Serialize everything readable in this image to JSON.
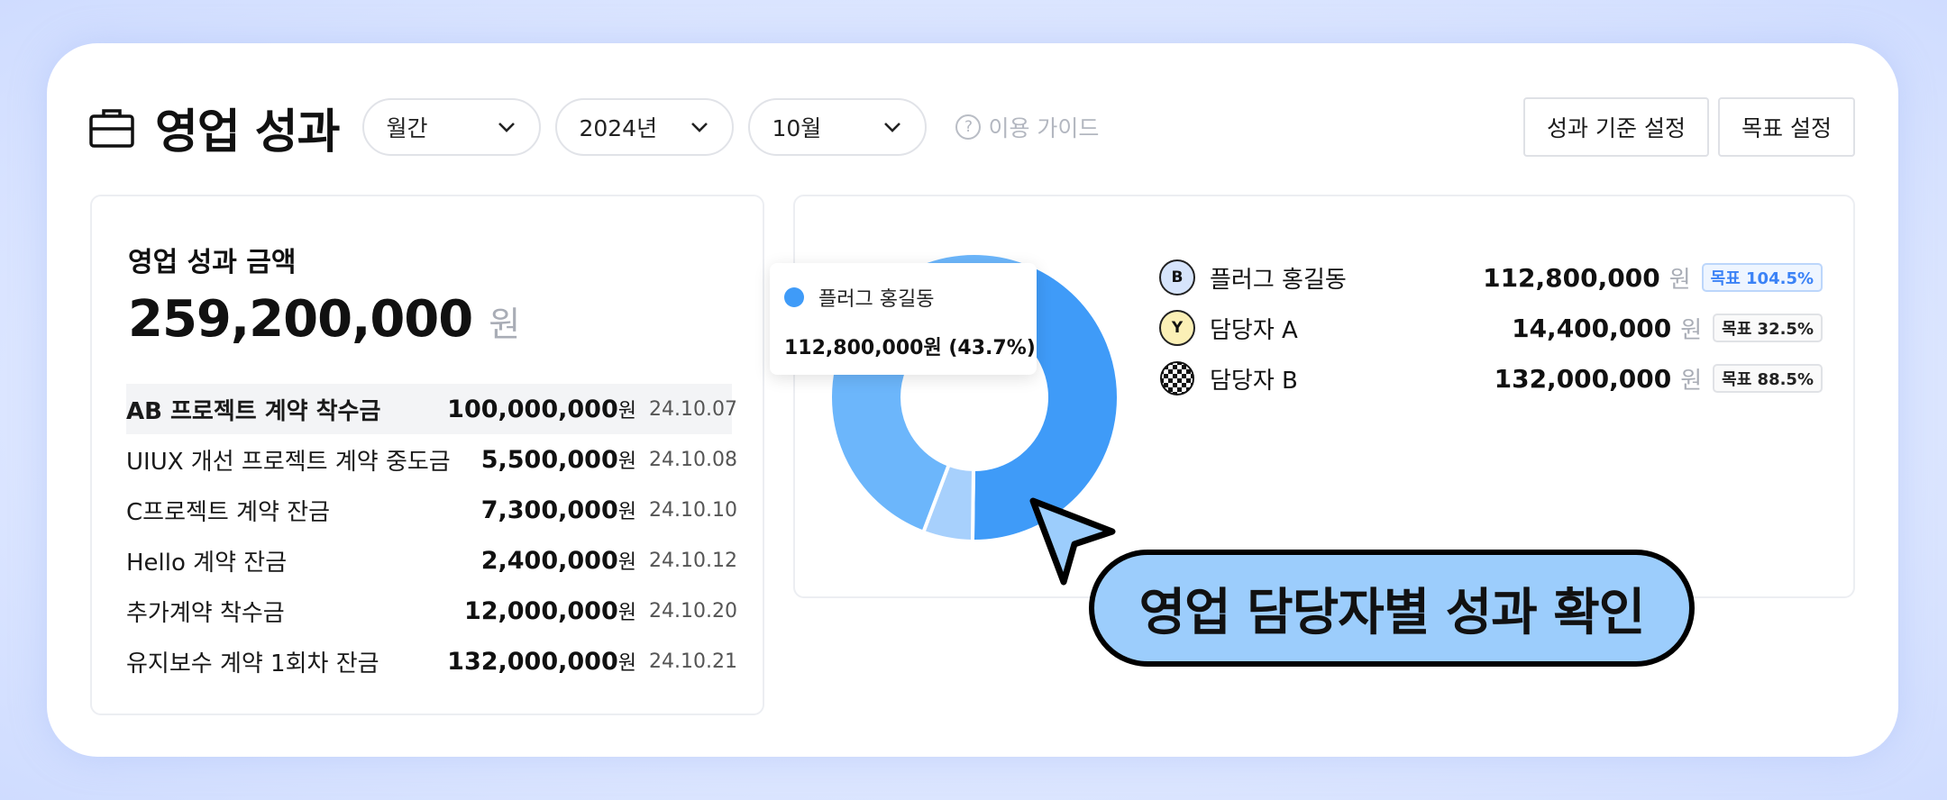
{
  "header": {
    "title": "영업 성과",
    "period_select": "월간",
    "year_select": "2024년",
    "month_select": "10월",
    "guide_label": "이용 가이드",
    "criteria_button": "성과 기준 설정",
    "goal_button": "목표 설정"
  },
  "summary": {
    "title": "영업 성과 금액",
    "amount": "259,200,000",
    "unit": "원"
  },
  "transactions": [
    {
      "name": "AB 프로젝트 계약 착수금",
      "amount": "100,000,000",
      "unit": "원",
      "date": "24.10.07"
    },
    {
      "name": "UIUX 개선 프로젝트 계약 중도금",
      "amount": "5,500,000",
      "unit": "원",
      "date": "24.10.08"
    },
    {
      "name": "C프로젝트 계약 잔금",
      "amount": "7,300,000",
      "unit": "원",
      "date": "24.10.10"
    },
    {
      "name": "Hello 계약 잔금",
      "amount": "2,400,000",
      "unit": "원",
      "date": "24.10.12"
    },
    {
      "name": "추가계약 착수금",
      "amount": "12,000,000",
      "unit": "원",
      "date": "24.10.20"
    },
    {
      "name": "유지보수 계약 1회차 잔금",
      "amount": "132,000,000",
      "unit": "원",
      "date": "24.10.21"
    }
  ],
  "tooltip": {
    "name": "플러그 홍길동",
    "value": "112,800,000원 (43.7%)"
  },
  "legend": [
    {
      "avatar": "B",
      "name": "플러그 홍길동",
      "amount": "112,800,000",
      "unit": "원",
      "badge": "목표 104.5%"
    },
    {
      "avatar": "Y",
      "name": "담당자 A",
      "amount": "14,400,000",
      "unit": "원",
      "badge": "목표 32.5%"
    },
    {
      "avatar": "",
      "name": "담당자 B",
      "amount": "132,000,000",
      "unit": "원",
      "badge": "목표 88.5%"
    }
  ],
  "donut": {
    "segments": [
      {
        "value": 112800000,
        "color": "#3f9bf8"
      },
      {
        "value": 14400000,
        "color": "#a7d0fc"
      },
      {
        "value": 132000000,
        "color": "#6cb6fb"
      }
    ]
  },
  "callout": "영업 담당자별 성과 확인",
  "colors": {
    "accent": "#3f9bf8",
    "callout_bg": "#9ccdfc",
    "badge_blue": "#3b82f6"
  }
}
